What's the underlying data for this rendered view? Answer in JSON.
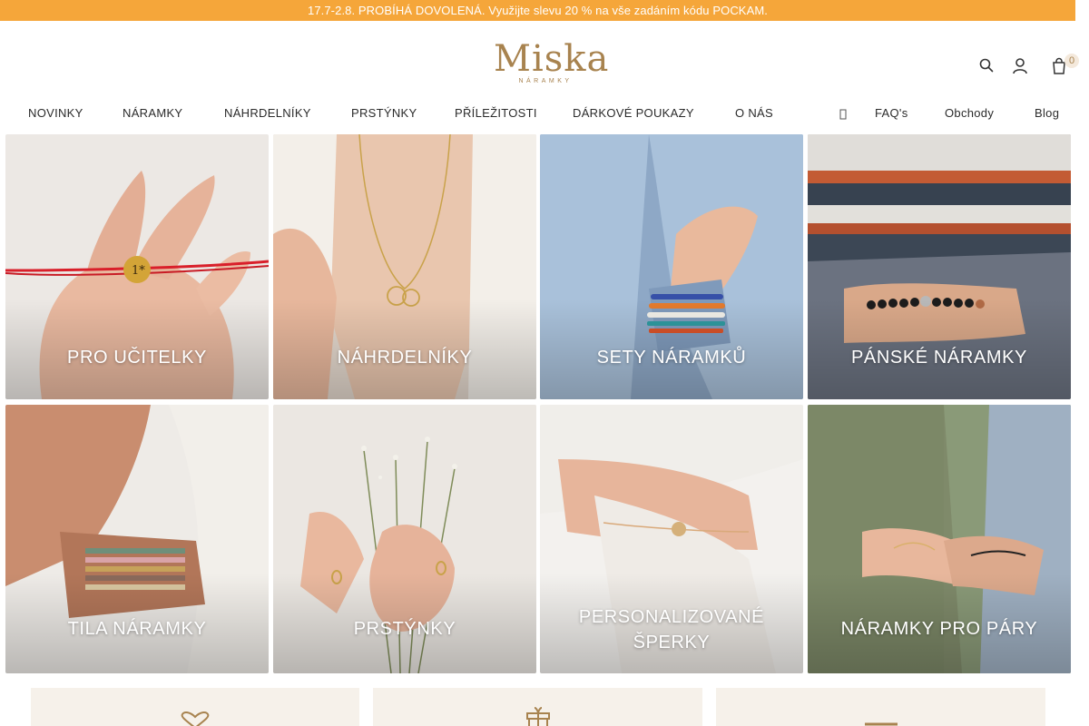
{
  "promo": {
    "text": "17.7-2.8. PROBÍHÁ DOVOLENÁ. Využijte slevu 20 % na vše zadáním kódu POCKAM."
  },
  "logo": {
    "main": "Miska",
    "sub": "NÁRAMKY"
  },
  "header": {
    "cart_count": "0"
  },
  "nav": {
    "main": [
      "NOVINKY",
      "NÁRAMKY",
      "NÁHRDELNÍKY",
      "PRSTÝNKY",
      "PŘÍLEŽITOSTI",
      "DÁRKOVÉ POUKAZY",
      "O NÁS"
    ],
    "secondary": [
      "FAQ's",
      "Obchody",
      "Blog"
    ]
  },
  "tiles": [
    {
      "label": "PRO UČITELKY"
    },
    {
      "label": "NÁHRDELNÍKY"
    },
    {
      "label": "SETY NÁRAMKŮ"
    },
    {
      "label": "PÁNSKÉ NÁRAMKY"
    },
    {
      "label": "TILA NÁRAMKY"
    },
    {
      "label": "PRSTÝNKY"
    },
    {
      "label": "PERSONALIZOVANÉ ŠPERKY"
    },
    {
      "label": "NÁRAMKY PRO PÁRY"
    }
  ],
  "icons": {
    "search": "search-icon",
    "user": "user-icon",
    "cart": "cart-icon",
    "benefit_1": "heart-icon",
    "benefit_2": "gift-icon",
    "benefit_3": "box-icon"
  },
  "colors": {
    "promo_bg": "#f5a63a",
    "brand_gold": "#a8834f",
    "benefit_bg": "#f6f1ea"
  }
}
